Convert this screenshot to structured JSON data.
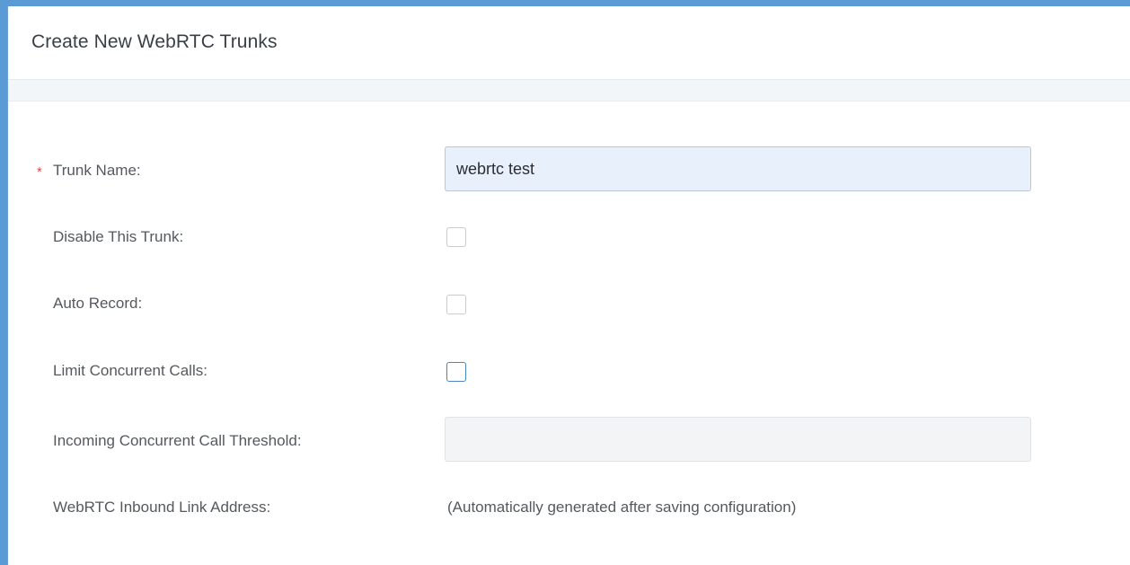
{
  "page": {
    "title": "Create New WebRTC Trunks"
  },
  "form": {
    "trunk_name": {
      "required_mark": "*",
      "label": "Trunk Name:",
      "value": "webrtc test"
    },
    "disable_trunk": {
      "label": "Disable This Trunk:",
      "checked": false
    },
    "auto_record": {
      "label": "Auto Record:",
      "checked": false
    },
    "limit_concurrent_calls": {
      "label": "Limit Concurrent Calls:",
      "checked": false
    },
    "incoming_threshold": {
      "label": "Incoming Concurrent Call Threshold:",
      "value": ""
    },
    "inbound_link": {
      "label": "WebRTC Inbound Link Address:",
      "value": "(Automatically generated after saving configuration)"
    }
  },
  "colors": {
    "required": "#e04b4b",
    "input_fill": "#e8f0fc",
    "focus_border": "#4a87c6"
  }
}
